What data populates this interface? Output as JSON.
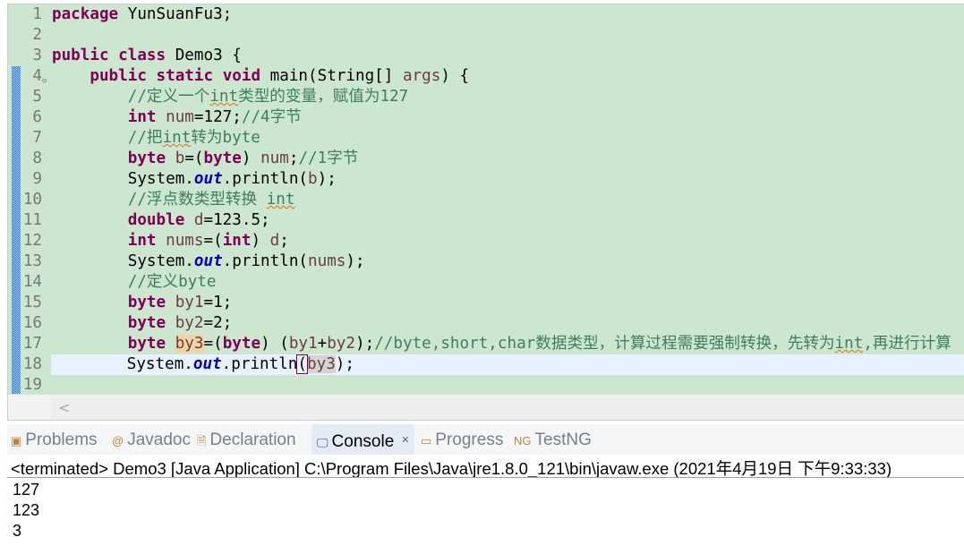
{
  "editor": {
    "lines": [
      [
        [
          "package",
          "kw"
        ],
        [
          " YunSuanFu3;",
          "pl"
        ]
      ],
      [],
      [
        [
          "public",
          "kw"
        ],
        [
          " ",
          "pl"
        ],
        [
          "class",
          "kw"
        ],
        [
          " Demo3 {",
          "pl"
        ]
      ],
      [
        [
          "    ",
          "pl"
        ],
        [
          "public",
          "kw"
        ],
        [
          " ",
          "pl"
        ],
        [
          "static",
          "kw"
        ],
        [
          " ",
          "pl"
        ],
        [
          "void",
          "kw"
        ],
        [
          " main(String[] ",
          "pl"
        ],
        [
          "args",
          "var"
        ],
        [
          ") {",
          "pl"
        ]
      ],
      [
        [
          "        //定义一个",
          "cm"
        ],
        [
          "int",
          "cm sq"
        ],
        [
          "类型的变量，赋值为127",
          "cm"
        ]
      ],
      [
        [
          "        ",
          "pl"
        ],
        [
          "int",
          "kw"
        ],
        [
          " ",
          "pl"
        ],
        [
          "num",
          "var"
        ],
        [
          "=127;",
          "pl"
        ],
        [
          "//4字节",
          "cm"
        ]
      ],
      [
        [
          "        //把",
          "cm"
        ],
        [
          "int",
          "cm sq"
        ],
        [
          "转为byte",
          "cm"
        ]
      ],
      [
        [
          "        ",
          "pl"
        ],
        [
          "byte",
          "kw"
        ],
        [
          " ",
          "pl"
        ],
        [
          "b",
          "var"
        ],
        [
          "=(",
          "pl"
        ],
        [
          "byte",
          "kw"
        ],
        [
          ") ",
          "pl"
        ],
        [
          "num",
          "var"
        ],
        [
          ";",
          "pl"
        ],
        [
          "//1字节",
          "cm"
        ]
      ],
      [
        [
          "        System.",
          "pl"
        ],
        [
          "out",
          "st"
        ],
        [
          ".println(",
          "pl"
        ],
        [
          "b",
          "var"
        ],
        [
          ");",
          "pl"
        ]
      ],
      [
        [
          "        //浮点数类型转换 ",
          "cm"
        ],
        [
          "int",
          "cm sq"
        ]
      ],
      [
        [
          "        ",
          "pl"
        ],
        [
          "double",
          "kw"
        ],
        [
          " ",
          "pl"
        ],
        [
          "d",
          "var"
        ],
        [
          "=123.5;",
          "pl"
        ]
      ],
      [
        [
          "        ",
          "pl"
        ],
        [
          "int",
          "kw"
        ],
        [
          " ",
          "pl"
        ],
        [
          "nums",
          "var"
        ],
        [
          "=(",
          "pl"
        ],
        [
          "int",
          "kw"
        ],
        [
          ") ",
          "pl"
        ],
        [
          "d",
          "var"
        ],
        [
          ";",
          "pl"
        ]
      ],
      [
        [
          "        System.",
          "pl"
        ],
        [
          "out",
          "st"
        ],
        [
          ".println(",
          "pl"
        ],
        [
          "nums",
          "var"
        ],
        [
          ");",
          "pl"
        ]
      ],
      [
        [
          "        //定义byte",
          "cm"
        ]
      ],
      [
        [
          "        ",
          "pl"
        ],
        [
          "byte",
          "kw"
        ],
        [
          " ",
          "pl"
        ],
        [
          "by1",
          "var"
        ],
        [
          "=1;",
          "pl"
        ]
      ],
      [
        [
          "        ",
          "pl"
        ],
        [
          "byte",
          "kw"
        ],
        [
          " ",
          "pl"
        ],
        [
          "by2",
          "var"
        ],
        [
          "=2;",
          "pl"
        ]
      ],
      [
        [
          "        ",
          "pl"
        ],
        [
          "byte",
          "kw"
        ],
        [
          " ",
          "pl"
        ],
        [
          "by3",
          "var occ"
        ],
        [
          "=(",
          "pl"
        ],
        [
          "byte",
          "kw"
        ],
        [
          ") (",
          "pl"
        ],
        [
          "by1",
          "var"
        ],
        [
          "+",
          "pl"
        ],
        [
          "by2",
          "var"
        ],
        [
          ");",
          "pl"
        ],
        [
          "//byte,short,char数据类型，计算过程需要强制转换，先转为",
          "cm"
        ],
        [
          "int",
          "cm sq"
        ],
        [
          ",再进行计算",
          "cm"
        ]
      ],
      [
        [
          "        System.",
          "pl"
        ],
        [
          "out",
          "st"
        ],
        [
          ".println",
          "pl"
        ],
        [
          "(",
          "pl br"
        ],
        [
          "by3",
          "var occ2"
        ],
        [
          ");",
          "pl"
        ]
      ],
      []
    ],
    "current_line": 18,
    "fold_line": 4,
    "scroll_left": "<"
  },
  "tabs": [
    {
      "label": "Problems",
      "icon": "problems-icon",
      "glyph": "▣"
    },
    {
      "label": "Javadoc",
      "icon": "at-icon",
      "glyph": "@"
    },
    {
      "label": "Declaration",
      "icon": "declaration-icon",
      "glyph": "🗎"
    },
    {
      "label": "Console",
      "icon": "console-icon",
      "glyph": "🖵",
      "active": true,
      "close": "✕"
    },
    {
      "label": "Progress",
      "icon": "progress-icon",
      "glyph": "▭"
    },
    {
      "label": "TestNG",
      "icon": "testng-icon",
      "glyph": "NG"
    }
  ],
  "console": {
    "status": "<terminated> Demo3 [Java Application] C:\\Program Files\\Java\\jre1.8.0_121\\bin\\javaw.exe (2021年4月19日 下午9:33:33)",
    "output": [
      "127",
      "123",
      "3"
    ]
  }
}
